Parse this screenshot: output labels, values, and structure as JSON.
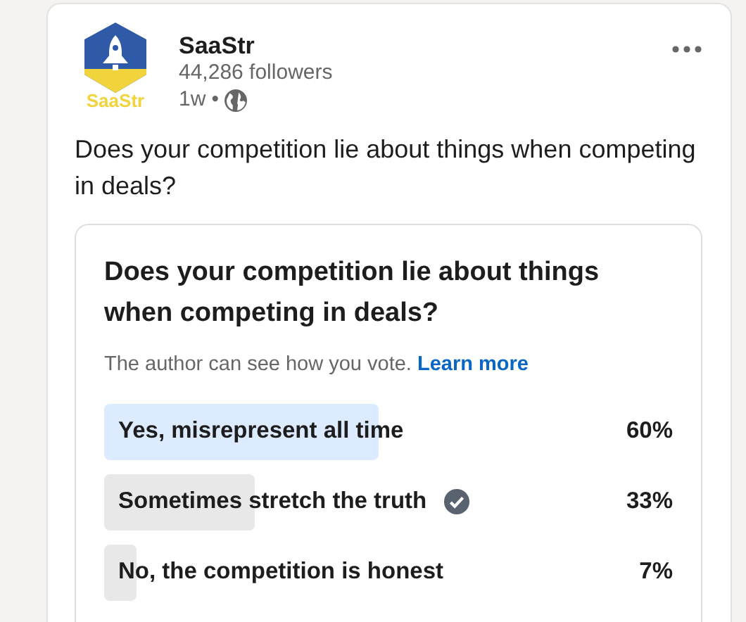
{
  "author": {
    "name": "SaaStr",
    "logo_text": "SaaStr",
    "followers": "44,286 followers",
    "time": "1w",
    "separator": "•"
  },
  "post_text": "Does your competition lie about things when competing in deals?",
  "poll": {
    "question": "Does your competition lie about things when competing in deals?",
    "note": "The author can see how you vote.",
    "link": "Learn more",
    "options": [
      {
        "label": "Yes, misrepresent all time",
        "percent": "60%",
        "leading": true,
        "selected": false
      },
      {
        "label": "Sometimes stretch the truth",
        "percent": "33%",
        "leading": false,
        "selected": true
      },
      {
        "label": "No, the competition is honest",
        "percent": "7%",
        "leading": false,
        "selected": false
      }
    ]
  }
}
